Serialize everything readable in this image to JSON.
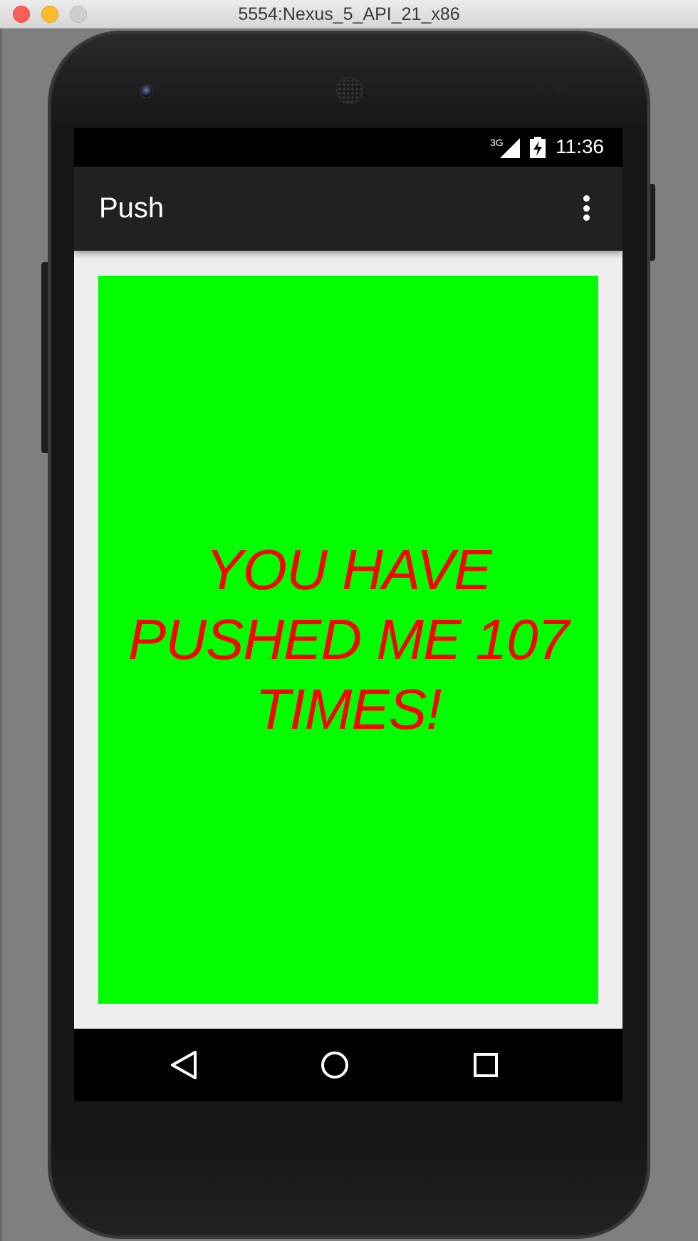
{
  "window": {
    "title": "5554:Nexus_5_API_21_x86"
  },
  "status_bar": {
    "network_label": "3G",
    "time": "11:36"
  },
  "app_bar": {
    "title": "Push",
    "overflow_icon": "more-vert-icon"
  },
  "main": {
    "message": "YOU HAVE PUSHED ME 107 TIMES!",
    "background_color": "#00ff00",
    "text_color": "#ff0000"
  },
  "nav_bar": {
    "icons": [
      "back-icon",
      "home-icon",
      "recents-icon"
    ]
  }
}
